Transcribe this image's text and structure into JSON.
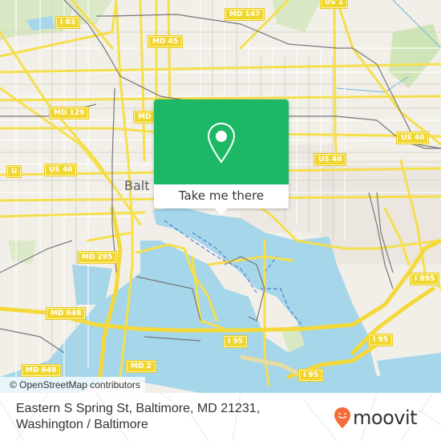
{
  "map": {
    "city_label": "Balt",
    "attribution": "© OpenStreetMap contributors",
    "colors": {
      "land": "#f2efe9",
      "water": "#a5d6ea",
      "road": "#f5e05a",
      "park": "#cfe5b8",
      "rail": "#6e6e6e",
      "accent": "#1db866"
    },
    "road_shields": [
      {
        "label": "I 83"
      },
      {
        "label": "MD 45"
      },
      {
        "label": "MD 147"
      },
      {
        "label": "US 1"
      },
      {
        "label": "MD 129"
      },
      {
        "label": "MD"
      },
      {
        "label": "US 40"
      },
      {
        "label": "U"
      },
      {
        "label": "US 40"
      },
      {
        "label": "US 40"
      },
      {
        "label": "MD 295"
      },
      {
        "label": "I 895"
      },
      {
        "label": "MD 648"
      },
      {
        "label": "MD 648"
      },
      {
        "label": "MD 2"
      },
      {
        "label": "I 95"
      },
      {
        "label": "I 95"
      },
      {
        "label": "I 95"
      }
    ]
  },
  "popup": {
    "icon": "map-pin-icon",
    "button_label": "Take me there"
  },
  "footer": {
    "address_line1": "Eastern S Spring St, Baltimore, MD 21231,",
    "address_line2": "Washington / Baltimore",
    "logo_text": "moovit",
    "logo_color": "#f26b3a"
  }
}
